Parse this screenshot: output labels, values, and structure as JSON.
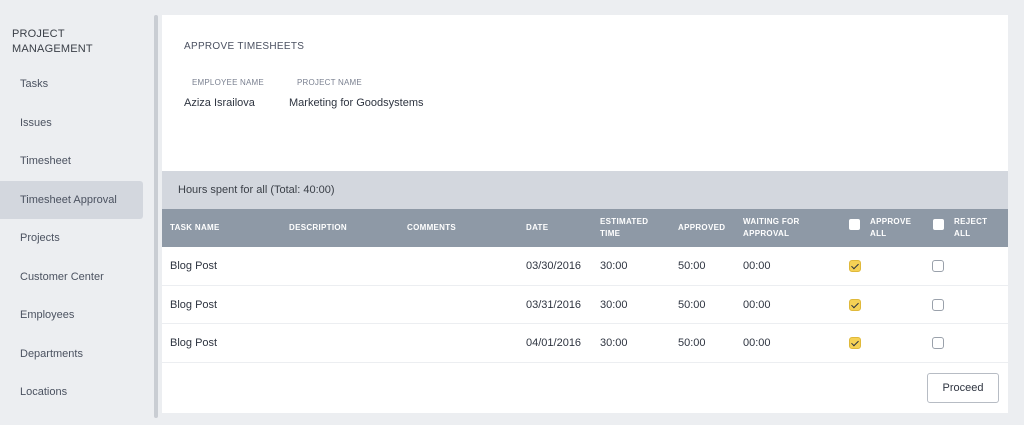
{
  "sidebar": {
    "title": "PROJECT MANAGEMENT",
    "items": [
      {
        "label": "Tasks"
      },
      {
        "label": "Issues"
      },
      {
        "label": "Timesheet"
      },
      {
        "label": "Timesheet Approval",
        "active": true
      },
      {
        "label": "Projects"
      },
      {
        "label": "Customer Center"
      },
      {
        "label": "Employees"
      },
      {
        "label": "Departments"
      },
      {
        "label": "Locations"
      }
    ]
  },
  "main": {
    "title": "APPROVE TIMESHEETS",
    "employee_label": "EMPLOYEE NAME",
    "employee_value": "Aziza Israilova",
    "project_label": "PROJECT NAME",
    "project_value": "Marketing for Goodsystems",
    "summary": "Hours spent for all (Total: 40:00)"
  },
  "table": {
    "headers": {
      "task": "TASK NAME",
      "description": "DESCRIPTION",
      "comments": "COMMENTS",
      "date": "DATE",
      "estimated": "ESTIMATED TIME",
      "approved": "APPROVED",
      "waiting": "WAITING FOR APPROVAL",
      "approve_all": "APPROVE ALL",
      "reject_all": "REJECT ALL"
    },
    "rows": [
      {
        "task": "Blog Post",
        "description": "",
        "comments": "",
        "date": "03/30/2016",
        "estimated": "30:00",
        "approved": "50:00",
        "waiting": "00:00",
        "approve": true,
        "reject": false
      },
      {
        "task": "Blog Post",
        "description": "",
        "comments": "",
        "date": "03/31/2016",
        "estimated": "30:00",
        "approved": "50:00",
        "waiting": "00:00",
        "approve": true,
        "reject": false
      },
      {
        "task": "Blog Post",
        "description": "",
        "comments": "",
        "date": "04/01/2016",
        "estimated": "30:00",
        "approved": "50:00",
        "waiting": "00:00",
        "approve": true,
        "reject": false
      }
    ]
  },
  "actions": {
    "proceed_label": "Proceed"
  },
  "colors": {
    "accent_checkbox": "#f5d155",
    "table_header": "#8e99a6",
    "summary_bar": "#d3d7de",
    "active_nav": "#d3d7de"
  }
}
